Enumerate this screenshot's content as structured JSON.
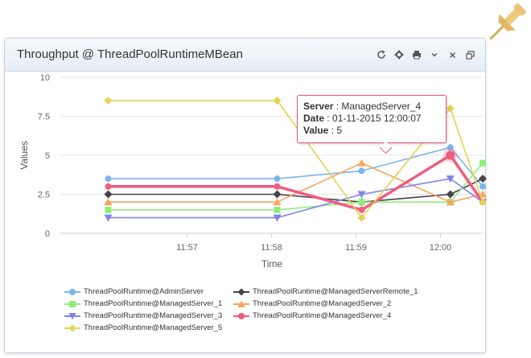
{
  "panel": {
    "title": "Throughput @ ThreadPoolRuntimeMBean"
  },
  "tools": [
    "refresh-icon",
    "gear-icon",
    "print-icon",
    "chevron-down-icon",
    "close-icon",
    "restore-icon"
  ],
  "tooltip": {
    "server_label": "Server",
    "server_value": "ManagedServer_4",
    "date_label": "Date",
    "date_value": "01-11-2015 12:00:07",
    "value_label": "Value",
    "value_value": "5"
  },
  "chart_data": {
    "type": "line",
    "xlabel": "Time",
    "ylabel": "Values",
    "ylim": [
      0,
      10
    ],
    "y_ticks": [
      "0",
      "2.5",
      "5",
      "7.5",
      "10"
    ],
    "x_tick_labels": [
      "11:57",
      "11:58",
      "11:59",
      "12:00"
    ],
    "x": [
      "11:56:04",
      "11:58:04",
      "11:59:04",
      "12:00:07",
      "12:00:30"
    ],
    "grid": true,
    "legend_position": "bottom",
    "series": [
      {
        "name": "ThreadPoolRuntime@AdminServer",
        "color": "#7cb5ec",
        "marker": "circle",
        "values": [
          3.5,
          3.5,
          4,
          5.5,
          3
        ]
      },
      {
        "name": "ThreadPoolRuntime@ManagedServerRemote_1",
        "color": "#434348",
        "marker": "diamond",
        "values": [
          2.5,
          2.5,
          2,
          2.5,
          3.5
        ]
      },
      {
        "name": "ThreadPoolRuntime@ManagedServer_1",
        "color": "#90ed7d",
        "marker": "square",
        "values": [
          1.5,
          1.5,
          2,
          2,
          4.5
        ]
      },
      {
        "name": "ThreadPoolRuntime@ManagedServer_2",
        "color": "#f7a35c",
        "marker": "triangle",
        "values": [
          2,
          2,
          4.5,
          2,
          2.5
        ]
      },
      {
        "name": "ThreadPoolRuntime@ManagedServer_3",
        "color": "#8085e9",
        "marker": "triangle-down",
        "values": [
          1,
          1,
          2.5,
          3.5,
          2
        ]
      },
      {
        "name": "ThreadPoolRuntime@ManagedServer_4",
        "color": "#f15c80",
        "marker": "circle",
        "values": [
          3,
          3,
          1.5,
          5,
          2
        ]
      },
      {
        "name": "ThreadPoolRuntime@ManagedServer_5",
        "color": "#e4d354",
        "marker": "diamond",
        "values": [
          8.5,
          8.5,
          1,
          8,
          2
        ]
      }
    ]
  }
}
